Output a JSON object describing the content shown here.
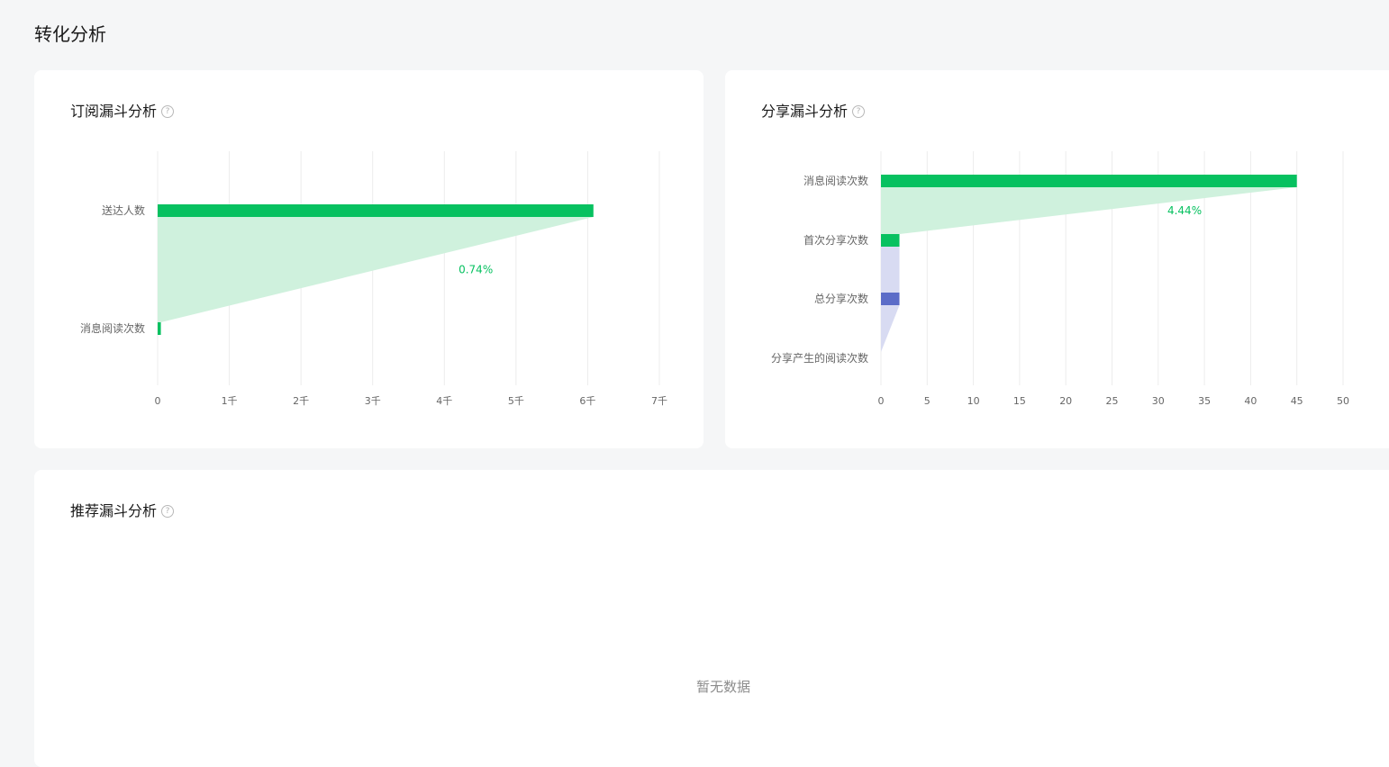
{
  "page": {
    "title": "转化分析"
  },
  "subscribe_funnel": {
    "title": "订阅漏斗分析",
    "help": "?",
    "chart_data": {
      "type": "bar",
      "orientation": "horizontal-funnel",
      "categories": [
        "送达人数",
        "消息阅读次数"
      ],
      "values": [
        6080,
        45
      ],
      "conversion_labels": [
        "0.74%"
      ],
      "xlim": [
        0,
        7000
      ],
      "xticks": [
        "0",
        "1千",
        "2千",
        "3千",
        "4千",
        "5千",
        "6千",
        "7千"
      ],
      "xtick_values": [
        0,
        1000,
        2000,
        3000,
        4000,
        5000,
        6000,
        7000
      ],
      "bar_colors": [
        "#07c160",
        "#07c160"
      ],
      "grid": true
    }
  },
  "share_funnel": {
    "title": "分享漏斗分析",
    "help": "?",
    "chart_data": {
      "type": "bar",
      "orientation": "horizontal-funnel",
      "categories": [
        "消息阅读次数",
        "首次分享次数",
        "总分享次数",
        "分享产生的阅读次数"
      ],
      "values": [
        45,
        2,
        2,
        0
      ],
      "conversion_labels": [
        "4.44%"
      ],
      "xlim": [
        0,
        50
      ],
      "xticks": [
        "0",
        "5",
        "10",
        "15",
        "20",
        "25",
        "30",
        "35",
        "40",
        "45",
        "50"
      ],
      "xtick_values": [
        0,
        5,
        10,
        15,
        20,
        25,
        30,
        35,
        40,
        45,
        50
      ],
      "bar_colors": [
        "#07c160",
        "#07c160",
        "#5b6cc8",
        "#5b6cc8"
      ],
      "grid": true
    }
  },
  "recommend_funnel": {
    "title": "推荐漏斗分析",
    "help": "?",
    "empty_text": "暂无数据"
  },
  "colors": {
    "green": "#07c160",
    "green_area": "#cff1dd",
    "blue": "#5b6cc8",
    "blue_area": "#d8dbf2",
    "grid": "#ececec",
    "label": "#666666",
    "pct": "#07c160"
  }
}
